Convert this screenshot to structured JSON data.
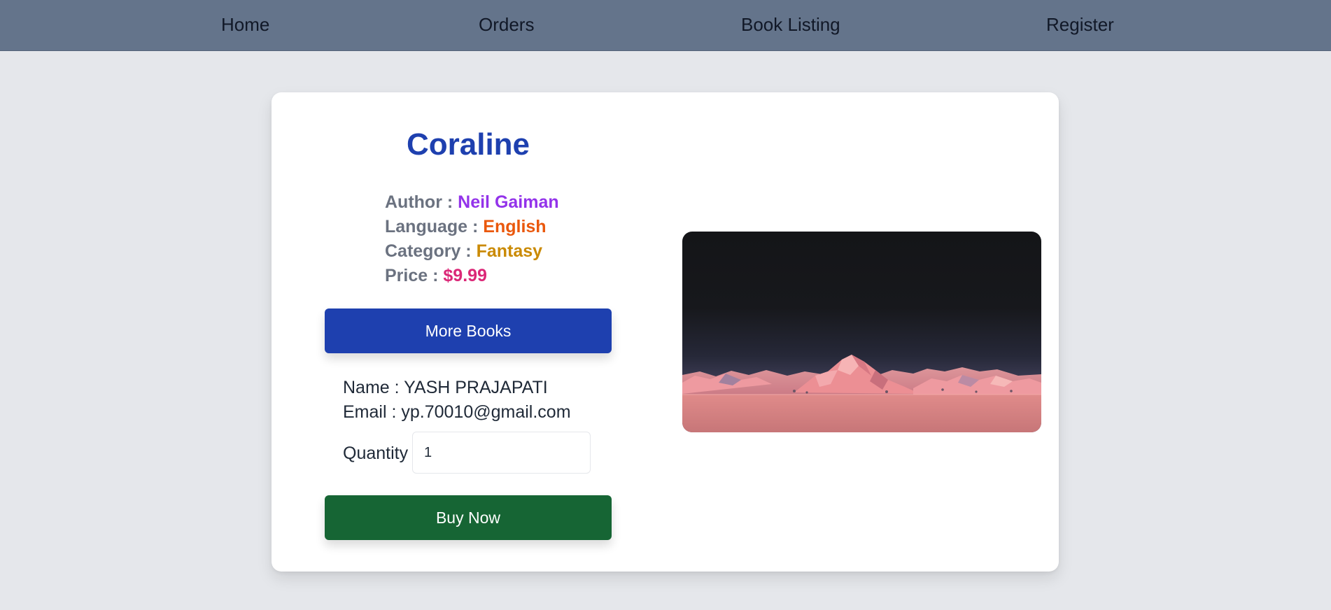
{
  "nav": {
    "items": [
      {
        "label": "Home"
      },
      {
        "label": "Orders"
      },
      {
        "label": "Book Listing"
      },
      {
        "label": "Register"
      }
    ]
  },
  "book": {
    "title": "Coraline",
    "author_label": "Author :",
    "author": "Neil Gaiman",
    "language_label": "Language :",
    "language": "English",
    "category_label": "Category :",
    "category": "Fantasy",
    "price_label": "Price :",
    "price": "$9.99"
  },
  "actions": {
    "more_books": "More Books",
    "buy_now": "Buy Now"
  },
  "user": {
    "name_line": "Name : YASH PRAJAPATI",
    "email_line": "Email : yp.70010@gmail.com"
  },
  "quantity": {
    "label": "Quantity",
    "value": "1"
  },
  "image": {
    "icon": "mountain-landscape-image"
  },
  "colors": {
    "nav_bg": "#64748b",
    "page_bg": "#e5e7eb",
    "title": "#1e40af",
    "author": "#9333ea",
    "language": "#ea580c",
    "category": "#ca8a04",
    "price": "#db2777",
    "more_books_button": "#1e40af",
    "buy_now_button": "#166534"
  }
}
